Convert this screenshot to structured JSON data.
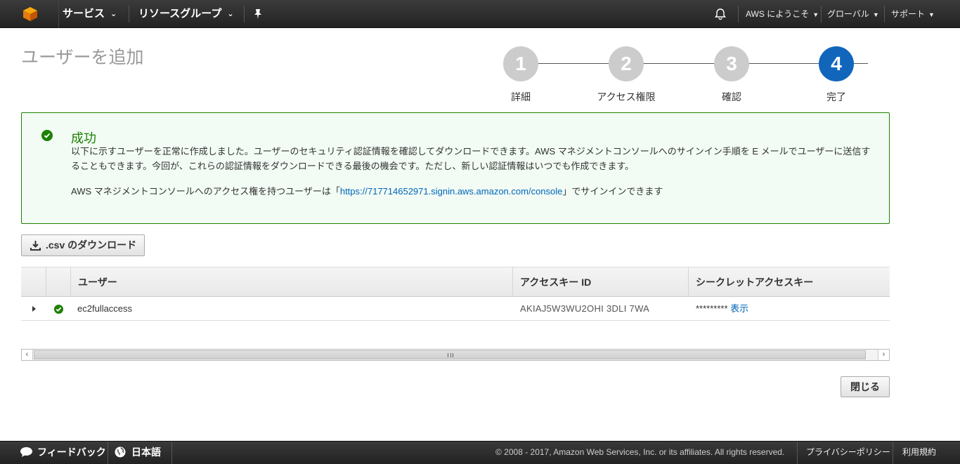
{
  "topnav": {
    "services": "サービス",
    "resource_groups": "リソースグループ",
    "account": "AWS にようこそ",
    "region": "グローバル",
    "support": "サポート"
  },
  "page": {
    "title": "ユーザーを追加"
  },
  "steps": [
    {
      "number": "1",
      "label": "詳細",
      "active": false
    },
    {
      "number": "2",
      "label": "アクセス権限",
      "active": false
    },
    {
      "number": "3",
      "label": "確認",
      "active": false
    },
    {
      "number": "4",
      "label": "完了",
      "active": true
    }
  ],
  "success": {
    "title": "成功",
    "message": "以下に示すユーザーを正常に作成しました。ユーザーのセキュリティ認証情報を確認してダウンロードできます。AWS マネジメントコンソールへのサインイン手順を E メールでユーザーに送信することもできます。今回が、これらの認証情報をダウンロードできる最後の機会です。ただし、新しい認証情報はいつでも作成できます。",
    "console_prefix": "AWS マネジメントコンソールへのアクセス権を持つユーザーは「",
    "console_url": "https://717714652971.signin.aws.amazon.com/console",
    "console_suffix": "」でサインインできます"
  },
  "download_button": ".csv のダウンロード",
  "table": {
    "headers": {
      "user": "ユーザー",
      "access_key_id": "アクセスキー ID",
      "secret_key": "シークレットアクセスキー"
    },
    "rows": [
      {
        "user": "ec2fullaccess",
        "access_key_id": "AKIAJ5W3WU2OHI 3DLI 7WA",
        "secret_masked": "*********",
        "show_link": "表示"
      }
    ]
  },
  "close_button": "閉じる",
  "footer": {
    "feedback": "フィードバック",
    "language": "日本語",
    "copyright": "© 2008 - 2017, Amazon Web Services, Inc. or its affiliates. All rights reserved.",
    "privacy": "プライバシーポリシー",
    "terms": "利用規約"
  }
}
